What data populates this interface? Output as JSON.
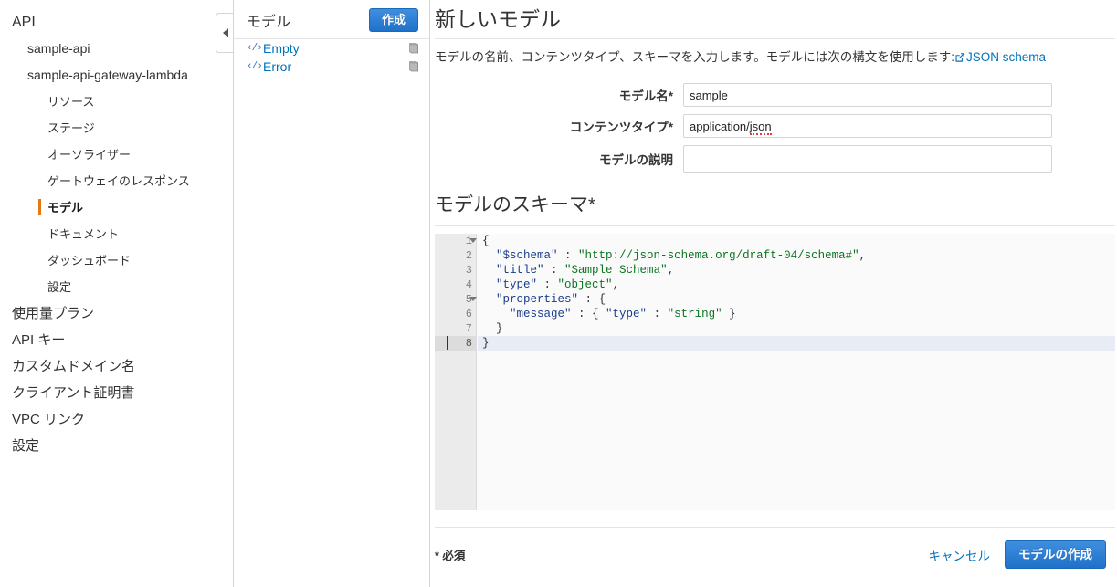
{
  "sidebar": {
    "items": [
      {
        "label": "API",
        "level": "root",
        "selected": false
      },
      {
        "label": "sample-api",
        "level": "lvl1",
        "selected": false
      },
      {
        "label": "sample-api-gateway-lambda",
        "level": "lvl1",
        "selected": false
      },
      {
        "label": "リソース",
        "level": "lvl2",
        "selected": false
      },
      {
        "label": "ステージ",
        "level": "lvl2",
        "selected": false
      },
      {
        "label": "オーソライザー",
        "level": "lvl2",
        "selected": false
      },
      {
        "label": "ゲートウェイのレスポンス",
        "level": "lvl2",
        "selected": false
      },
      {
        "label": "モデル",
        "level": "lvl2",
        "selected": true
      },
      {
        "label": "ドキュメント",
        "level": "lvl2",
        "selected": false
      },
      {
        "label": "ダッシュボード",
        "level": "lvl2",
        "selected": false
      },
      {
        "label": "設定",
        "level": "lvl2",
        "selected": false
      },
      {
        "label": "使用量プラン",
        "level": "top",
        "selected": false
      },
      {
        "label": "API キー",
        "level": "top",
        "selected": false
      },
      {
        "label": "カスタムドメイン名",
        "level": "top",
        "selected": false
      },
      {
        "label": "クライアント証明書",
        "level": "top",
        "selected": false
      },
      {
        "label": "VPC リンク",
        "level": "top",
        "selected": false
      },
      {
        "label": "設定",
        "level": "top",
        "selected": false
      }
    ],
    "collapse_handle_icon": "chevron-left-icon"
  },
  "list_panel": {
    "title": "モデル",
    "create_label": "作成",
    "models": [
      {
        "name": "Empty",
        "left_icon": "code-brackets-icon",
        "right_icon": "book-icon"
      },
      {
        "name": "Error",
        "left_icon": "code-brackets-icon",
        "right_icon": "book-icon"
      }
    ]
  },
  "main": {
    "title": "新しいモデル",
    "description_prefix": "モデルの名前、コンテンツタイプ、スキーマを入力します。モデルには次の構文を使用します:",
    "description_link": "JSON schema",
    "link_icon": "external-link-icon",
    "form": {
      "fields": [
        {
          "label": "モデル名*",
          "value": "sample",
          "placeholder": "",
          "misspelled": false
        },
        {
          "label": "コンテンツタイプ*",
          "value": "application/json",
          "placeholder": "",
          "misspelled": true
        },
        {
          "label": "モデルの説明",
          "value": "",
          "placeholder": "",
          "misspelled": false
        }
      ]
    },
    "schema": {
      "title": "モデルのスキーマ*",
      "lines": [
        {
          "n": "1",
          "fold": true,
          "active": false,
          "text": "{"
        },
        {
          "n": "2",
          "fold": false,
          "active": false,
          "text": "  \"$schema\" : \"http://json-schema.org/draft-04/schema#\","
        },
        {
          "n": "3",
          "fold": false,
          "active": false,
          "text": "  \"title\" : \"Sample Schema\","
        },
        {
          "n": "4",
          "fold": false,
          "active": false,
          "text": "  \"type\" : \"object\","
        },
        {
          "n": "5",
          "fold": true,
          "active": false,
          "text": "  \"properties\" : {"
        },
        {
          "n": "6",
          "fold": false,
          "active": false,
          "text": "    \"message\" : { \"type\" : \"string\" }"
        },
        {
          "n": "7",
          "fold": false,
          "active": false,
          "text": "  }"
        },
        {
          "n": "8",
          "fold": false,
          "active": true,
          "text": "}"
        }
      ]
    },
    "footer": {
      "required_note": "* 必須",
      "cancel_label": "キャンセル",
      "create_label": "モデルの作成"
    }
  },
  "colors": {
    "accent_orange": "#e47911",
    "link_blue": "#0073bb",
    "button_blue": "#1f72c9",
    "code_key": "#1a3c8c",
    "code_string": "#0b7520",
    "spellcheck_red": "#e03a3a"
  }
}
